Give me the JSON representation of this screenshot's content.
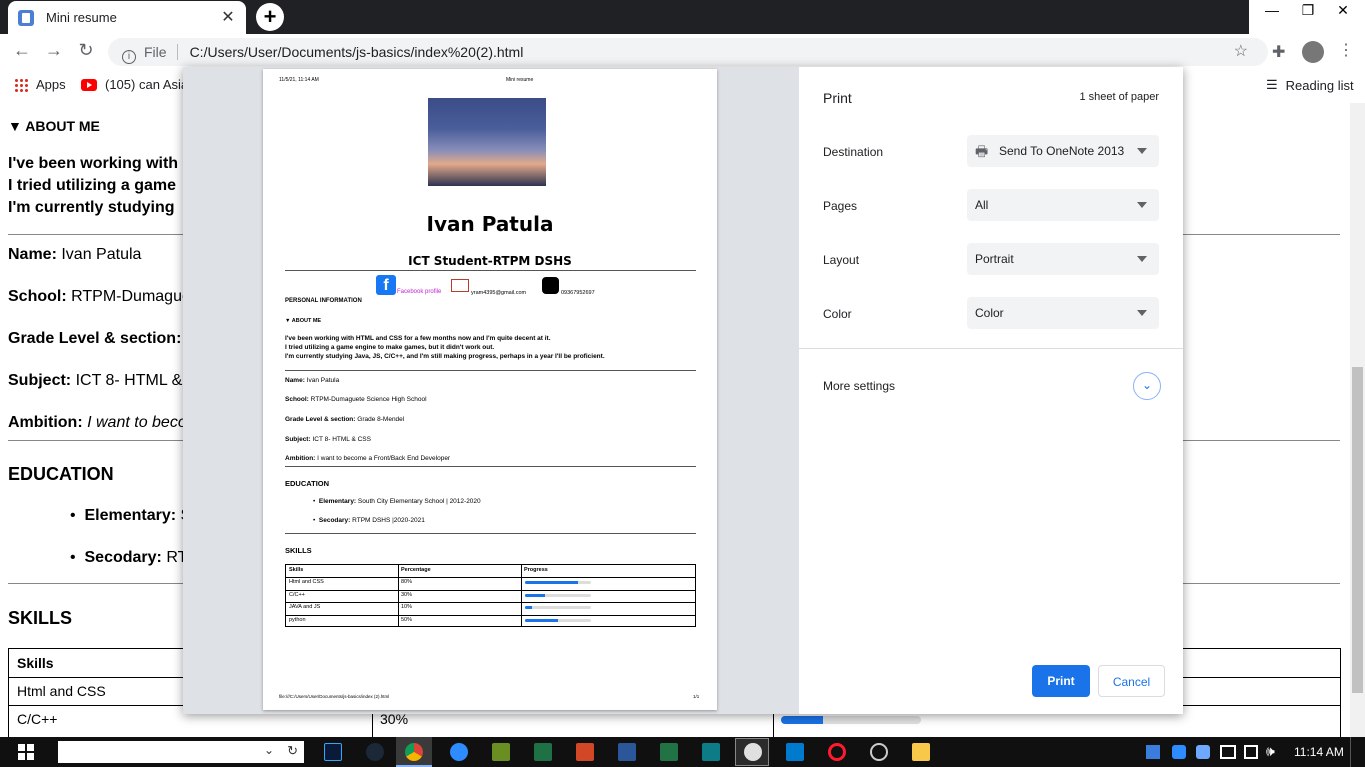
{
  "browser": {
    "tab_title": "Mini resume",
    "tab_close": "✕",
    "new_tab": "+",
    "window_minimize": "—",
    "window_restore": "❐",
    "window_close": "✕",
    "protocol_label": "File",
    "url": "C:/Users/User/Documents/js-basics/index%20(2).html",
    "bookmarks": {
      "apps": "Apps",
      "youtube": "(105) can Asian",
      "reading_list": "Reading list"
    }
  },
  "page": {
    "about_heading": "▼ ABOUT ME",
    "about_lines": [
      "I've been working with",
      "I tried utilizing a game",
      "I'm currently studying"
    ],
    "name_label": "Name:",
    "name_value": "Ivan Patula",
    "school_label": "School:",
    "school_value": "RTPM-Dumague",
    "grade_label": "Grade Level & section:",
    "grade_value": "G",
    "subject_label": "Subject:",
    "subject_value": "ICT 8- HTML &",
    "ambition_label": "Ambition:",
    "ambition_value": "I want to beco",
    "education_heading": "EDUCATION",
    "elementary_label": "Elementary:",
    "elementary_value": "S",
    "secondary_label": "Secodary:",
    "secondary_value": "RT",
    "skills_heading": "SKILLS",
    "table_header": "Skills",
    "rows": [
      {
        "skill": "Html and CSS",
        "pct": ""
      },
      {
        "skill": "C/C++",
        "pct": "30%",
        "progress": 0.3
      }
    ]
  },
  "preview": {
    "header_date": "11/5/21, 11:14 AM",
    "header_title": "Mini resume",
    "name": "Ivan Patula",
    "subtitle": "ICT Student-RTPM DSHS",
    "personal_info": "PERSONAL INFORMATION",
    "facebook": "Facebook profile",
    "email": "yram4395@gmail.com",
    "phone": "09367952697",
    "about_me": "▼ ABOUT ME",
    "about_lines": [
      "I've been working with HTML and CSS for a few months now and I'm quite decent at it.",
      "I tried utilizing a game engine to make games, but it didn't work out.",
      "I'm currently studying Java, JS, C/C++, and I'm still making progress, perhaps in a year I'll be proficient."
    ],
    "fields": [
      {
        "label": "Name:",
        "value": "Ivan Patula"
      },
      {
        "label": "School:",
        "value": "RTPM-Dumaguete Science High School"
      },
      {
        "label": "Grade Level & section:",
        "value": "Grade 8-Mendel"
      },
      {
        "label": "Subject:",
        "value": "ICT 8- HTML & CSS"
      },
      {
        "label": "Ambition:",
        "value": "I want to become a Front/Back End Developer"
      }
    ],
    "education": "EDUCATION",
    "edu_items": [
      {
        "label": "Elementary:",
        "value": "South City Elementary School | 2012-2020"
      },
      {
        "label": "Secodary:",
        "value": "RTPM DSHS |2020-2021"
      }
    ],
    "skills": "SKILLS",
    "table_headers": [
      "Skills",
      "Percentage",
      "Progress"
    ],
    "table_rows": [
      {
        "skill": "Html and CSS",
        "pct": "80%",
        "progress": 0.8
      },
      {
        "skill": "C/C++",
        "pct": "30%",
        "progress": 0.3
      },
      {
        "skill": "JAVA and JS",
        "pct": "10%",
        "progress": 0.1
      },
      {
        "skill": "python",
        "pct": "50%",
        "progress": 0.5
      }
    ],
    "footer_path": "file:///C:/Users/User/Documents/js-basics/index (2).html",
    "footer_page": "1/1"
  },
  "print": {
    "title": "Print",
    "sheets": "1 sheet of paper",
    "destination_label": "Destination",
    "destination_value": "Send To OneNote 2013",
    "pages_label": "Pages",
    "pages_value": "All",
    "layout_label": "Layout",
    "layout_value": "Portrait",
    "color_label": "Color",
    "color_value": "Color",
    "more_settings": "More settings",
    "print_button": "Print",
    "cancel_button": "Cancel",
    "accent": "#1a73e8"
  },
  "taskbar": {
    "time": "11:14 AM"
  }
}
